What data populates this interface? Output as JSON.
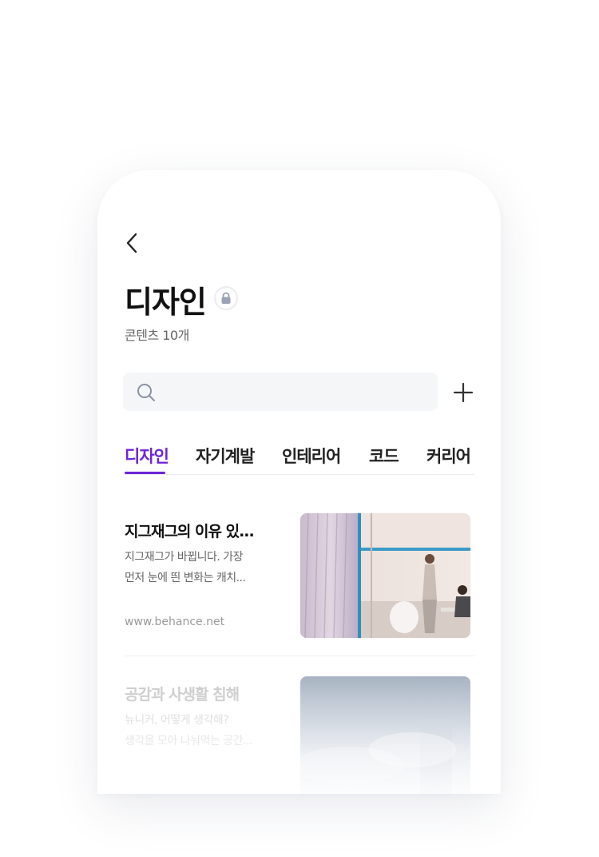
{
  "header": {
    "back_icon": "chevron-left-icon",
    "title": "디자인",
    "lock_icon": "lock-icon",
    "content_count": "콘텐츠 10개"
  },
  "search": {
    "placeholder": "",
    "icon": "search-icon"
  },
  "add_icon": "plus-icon",
  "tabs": [
    {
      "label": "디자인",
      "active": true
    },
    {
      "label": "자기계발",
      "active": false
    },
    {
      "label": "인테리어",
      "active": false
    },
    {
      "label": "코드",
      "active": false
    },
    {
      "label": "커리어",
      "active": false
    }
  ],
  "cards": [
    {
      "title": "지그재그의 이유 있...",
      "desc_line1": "지그재그가 바뀝니다. 가장",
      "desc_line2": "먼저 눈에 띈 변화는 캐치...",
      "source": "www.behance.net"
    },
    {
      "title": "공감과 사생활 침해",
      "desc_line1": "뉴니커, 어떻게 생각해?",
      "desc_line2": "생각을 모아 나눠먹는 공간..."
    }
  ],
  "colors": {
    "accent": "#6c24d8",
    "title_text": "#111111",
    "secondary_text": "#666666",
    "search_bg": "#f5f6f8"
  }
}
